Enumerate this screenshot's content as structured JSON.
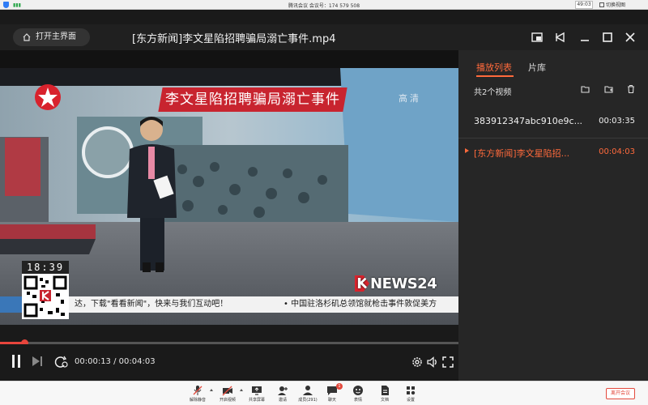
{
  "meeting_bar": {
    "info": "腾讯会议  会议号：174 579 508",
    "timer": "49:03",
    "view_label": "切换视图"
  },
  "player": {
    "home_label": "打开主界面",
    "file_title": "[东方新闻]李文星陷招聘骗局溺亡事件.mp4"
  },
  "video": {
    "headline": "李文星陷招聘骗局溺亡事件",
    "hd_label": "高清",
    "clock": "18:39",
    "ticker_left": "达，下载\"看看新闻\"，快来与我们互动吧！",
    "ticker_right": "• 中国驻洛杉矶总领馆就枪击事件敦促美方",
    "channel_logo": "NEWS24",
    "channel_logo_k": "K"
  },
  "controls": {
    "current_time": "00:00:13",
    "separator": " / ",
    "total_time": "00:04:03",
    "progress_fraction": 0.053
  },
  "sidebar": {
    "tabs": [
      {
        "label": "播放列表",
        "active": true
      },
      {
        "label": "片库",
        "active": false
      }
    ],
    "count_label": "共2个视频",
    "items": [
      {
        "name": "383912347abc910e9c...",
        "duration": "00:03:35",
        "playing": false
      },
      {
        "name": "[东方新闻]李文星陷招...",
        "duration": "00:04:03",
        "playing": true
      }
    ]
  },
  "toolbar": {
    "items": [
      {
        "label": "解除静音",
        "icon": "mic-muted-icon"
      },
      {
        "label": "开启视频",
        "icon": "camera-off-icon"
      },
      {
        "label": "共享屏幕",
        "icon": "share-screen-icon"
      },
      {
        "label": "邀请",
        "icon": "invite-icon"
      },
      {
        "label": "成员(291)",
        "icon": "members-icon"
      },
      {
        "label": "聊天",
        "icon": "chat-icon"
      },
      {
        "label": "表情",
        "icon": "emoji-icon"
      },
      {
        "label": "文档",
        "icon": "document-icon"
      },
      {
        "label": "设置",
        "icon": "settings-icon"
      }
    ],
    "chat_badge": "1",
    "leave_label": "离开会议"
  },
  "colors": {
    "accent": "#ff6a3c",
    "progress": "#e8453c",
    "headline_red": "#c8242f",
    "leave_red": "#e34a3d"
  }
}
